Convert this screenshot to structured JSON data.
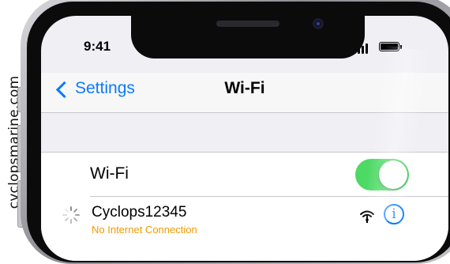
{
  "watermark": {
    "text": "cvclopsmarine.com"
  },
  "status_bar": {
    "time": "9:41",
    "signal_icon": "cellular-signal-icon",
    "battery_icon": "battery-icon"
  },
  "nav": {
    "back_label": "Settings",
    "back_icon": "chevron-left-icon",
    "title": "Wi-Fi"
  },
  "wifi_toggle": {
    "label": "Wi-Fi",
    "state": "on",
    "color": "#4cd964"
  },
  "network": {
    "name": "Cyclops12345",
    "status": "No Internet Connection",
    "status_color": "#f09a00",
    "connecting_icon": "loading-spinner-icon",
    "signal_icon": "wifi-signal-icon",
    "info_icon": "info-icon"
  },
  "colors": {
    "accent": "#0a7aff",
    "background": "#efeff4"
  }
}
